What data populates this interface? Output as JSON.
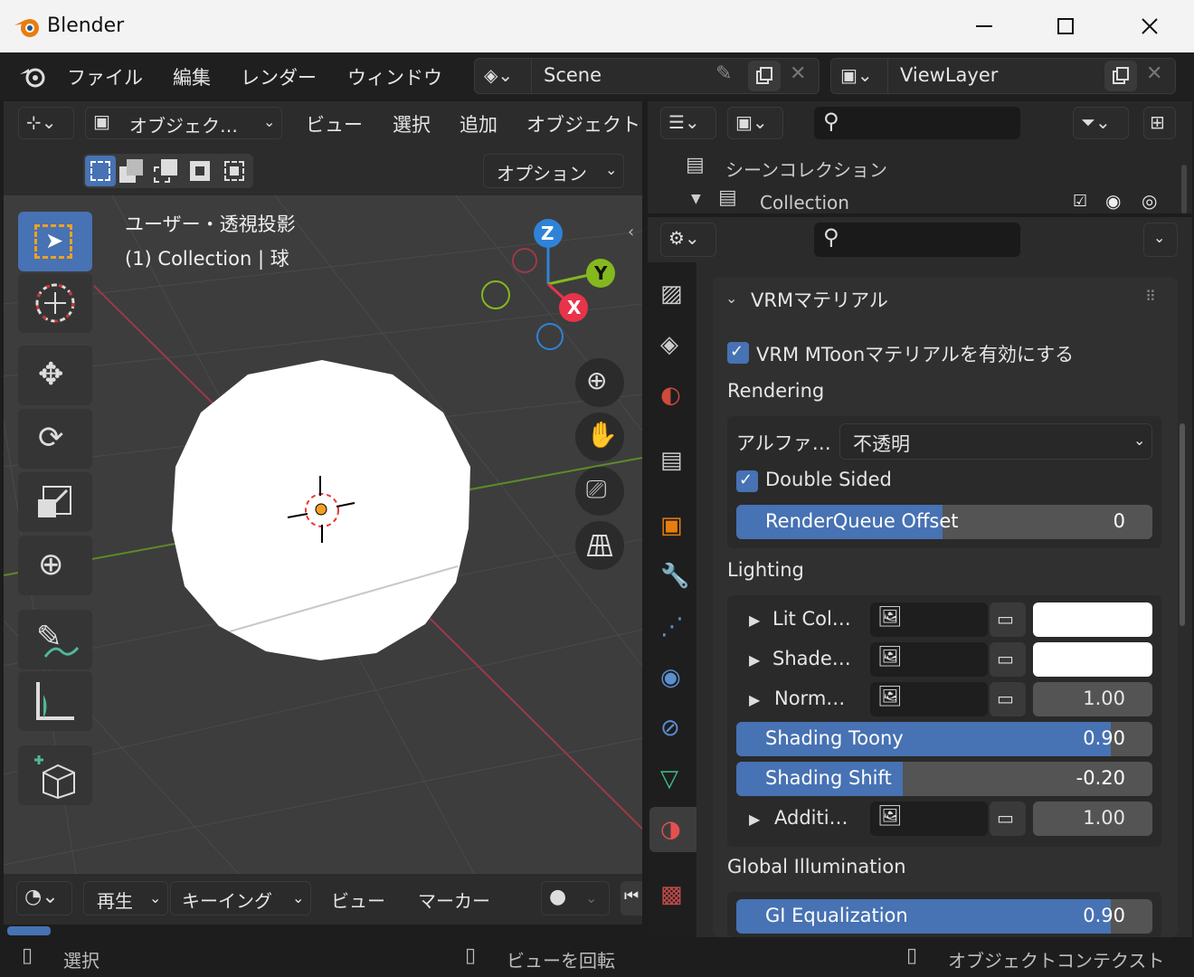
{
  "window": {
    "title": "Blender"
  },
  "menubar": {
    "items": [
      "ファイル",
      "編集",
      "レンダー",
      "ウィンドウ"
    ],
    "scene_name": "Scene",
    "view_layer_name": "ViewLayer"
  },
  "viewport_header": {
    "mode": "オブジェク…",
    "menus": [
      "ビュー",
      "選択",
      "追加",
      "オブジェクト"
    ],
    "options_label": "オプション"
  },
  "viewport": {
    "view_name": "ユーザー・透視投影",
    "object_info": "(1) Collection | 球",
    "gizmo_axes": [
      "Z",
      "Y",
      "X"
    ]
  },
  "timeline": {
    "menus": [
      "再生",
      "キーイング",
      "ビュー",
      "マーカー"
    ]
  },
  "status_bar": {
    "items": [
      "選択",
      "ビューを回転",
      "オブジェクトコンテクスト"
    ]
  },
  "outliner": {
    "scene_collection": "シーンコレクション",
    "collection": "Collection"
  },
  "properties": {
    "panel_title": "VRMマテリアル",
    "enable_mtoon": "VRM MToonマテリアルを有効にする",
    "rendering": {
      "heading": "Rendering",
      "alpha_label": "アルファ…",
      "alpha_value": "不透明",
      "double_sided": "Double Sided",
      "render_queue_label": "RenderQueue Offset",
      "render_queue_value": "0"
    },
    "lighting": {
      "heading": "Lighting",
      "lit_color": "Lit Col…",
      "shade_color": "Shade…",
      "normal": "Norm…",
      "normal_value": "1.00",
      "shading_toony_label": "Shading Toony",
      "shading_toony_value": "0.90",
      "shading_toony_fraction": 0.9,
      "shading_shift_label": "Shading Shift",
      "shading_shift_value": "-0.20",
      "shading_shift_fraction": 0.4,
      "additive": "Additi…",
      "additive_value": "1.00"
    },
    "gi": {
      "heading": "Global Illumination",
      "gi_equalization_label": "GI Equalization",
      "gi_equalization_value": "0.90",
      "gi_equalization_fraction": 0.9
    }
  },
  "colors": {
    "accent": "#4772b3",
    "axis_x": "#e8334a",
    "axis_y": "#84b81e",
    "axis_z": "#2f83d7",
    "blender_orange": "#e87d0d"
  }
}
